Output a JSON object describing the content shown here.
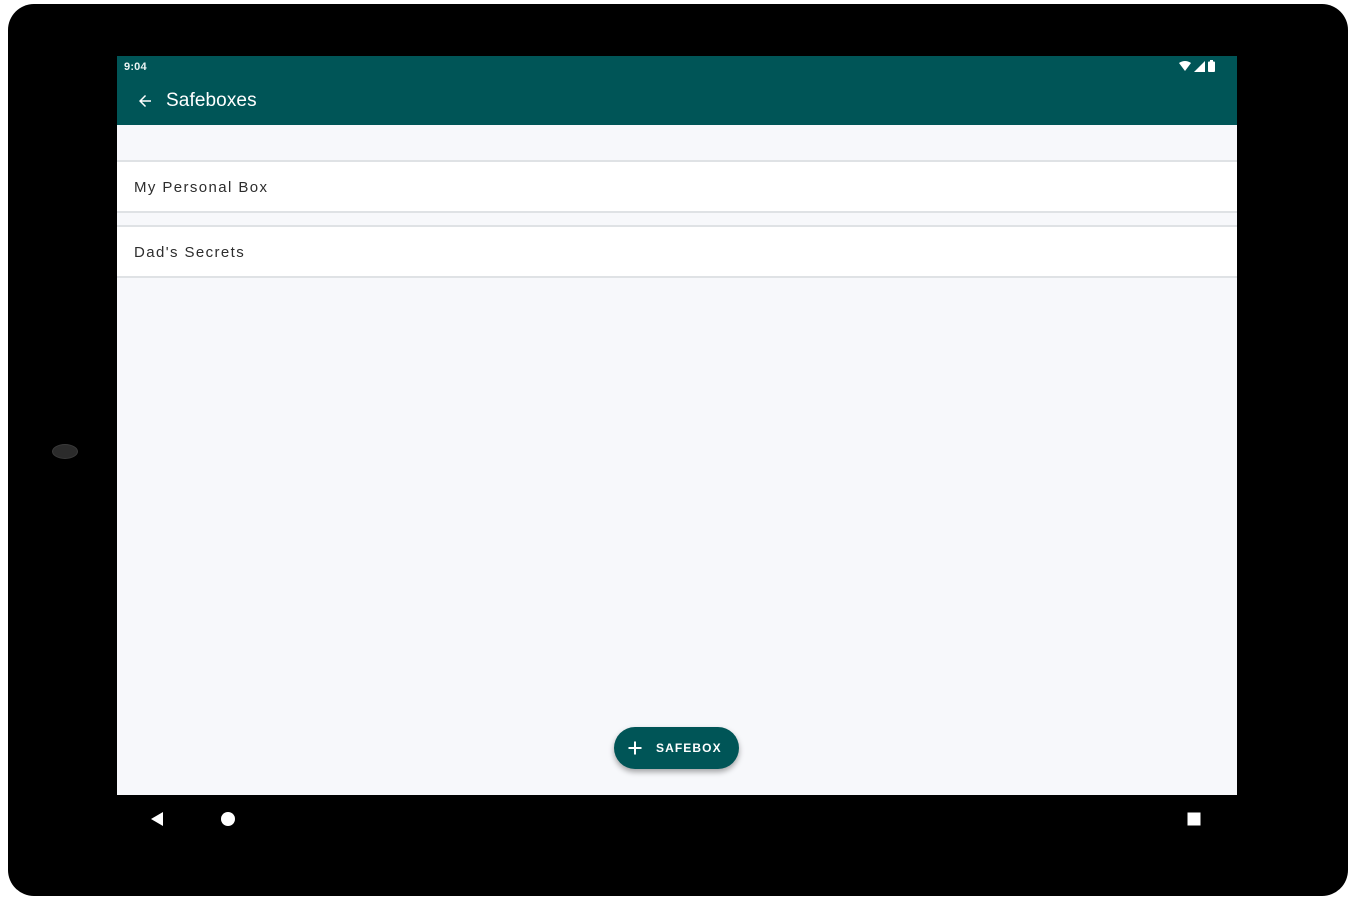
{
  "status_bar": {
    "time": "9:04",
    "icons": [
      "wifi-icon",
      "cellular-signal-icon",
      "battery-icon"
    ]
  },
  "app_bar": {
    "back_icon": "arrow-back-icon",
    "title": "Safeboxes"
  },
  "safeboxes": [
    {
      "label": "My Personal Box"
    },
    {
      "label": "Dad's Secrets"
    }
  ],
  "fab": {
    "icon": "plus-icon",
    "label": "SAFEBOX"
  },
  "navigation": {
    "icons": [
      "nav-back-icon",
      "nav-home-icon",
      "nav-recents-icon"
    ]
  },
  "colors": {
    "primary": "#005557",
    "background": "#f7f8fb",
    "surface": "#ffffff",
    "divider": "#dfe2e5",
    "text": "#2d2d2d"
  }
}
